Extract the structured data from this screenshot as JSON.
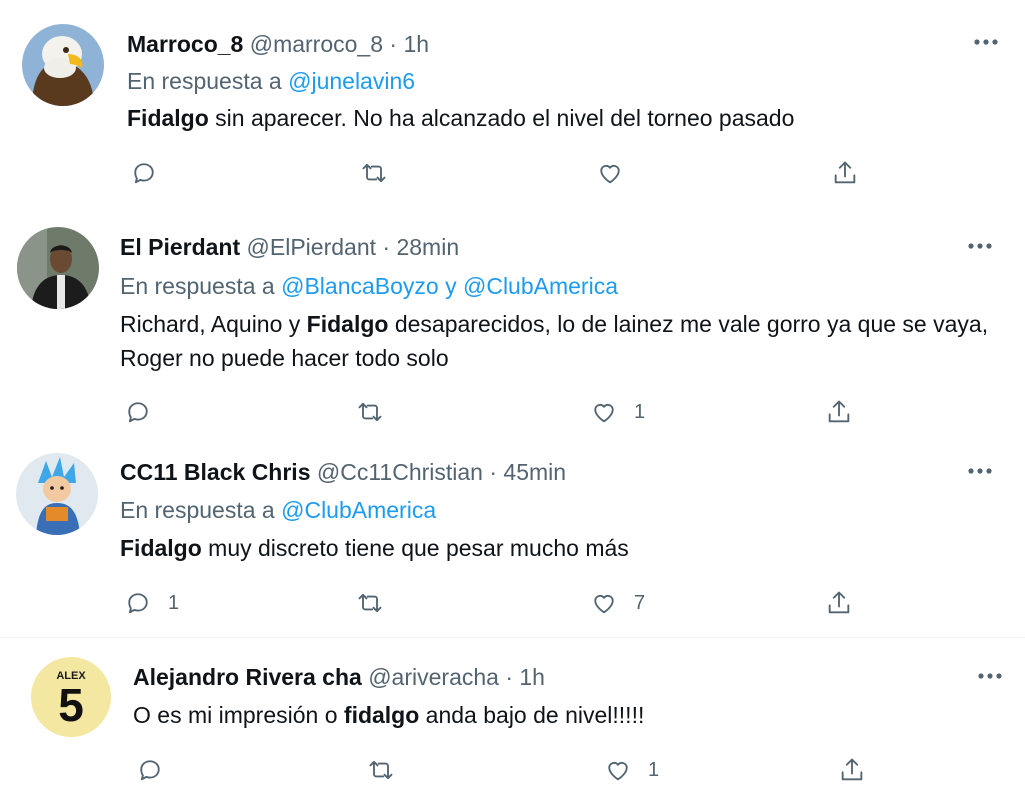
{
  "tweets": [
    {
      "display_name": "Marroco_8",
      "handle": "@marroco_8",
      "dot": "·",
      "time": "1h",
      "reply_prefix": "En respuesta a",
      "reply_to": "@junelavin6",
      "text": [
        {
          "t": "Fidalgo",
          "b": true
        },
        {
          "t": " sin aparecer. No ha alcanzado el nivel del torneo pasado",
          "b": false
        }
      ],
      "counts": {
        "reply": "",
        "retweet": "",
        "like": "",
        "share": ""
      },
      "avatar_icon": "eagle-avatar"
    },
    {
      "display_name": "El Pierdant",
      "handle": "@ElPierdant",
      "dot": "·",
      "time": "28min",
      "reply_prefix": "En respuesta a",
      "reply_to": "@BlancaBoyzo y @ClubAmerica",
      "text": [
        {
          "t": "Richard, Aquino y ",
          "b": false
        },
        {
          "t": "Fidalgo",
          "b": true
        },
        {
          "t": " desaparecidos, lo de lainez me vale gorro ya que se vaya, Roger no puede hacer todo solo",
          "b": false
        }
      ],
      "counts": {
        "reply": "",
        "retweet": "",
        "like": "1",
        "share": ""
      },
      "avatar_icon": "person-photo-avatar"
    },
    {
      "display_name": "CC11 Black Chris",
      "handle": "@Cc11Christian",
      "dot": "·",
      "time": "45min",
      "reply_prefix": "En respuesta a",
      "reply_to": "@ClubAmerica",
      "text": [
        {
          "t": "Fidalgo",
          "b": true
        },
        {
          "t": " muy discreto tiene que pesar mucho más",
          "b": false
        }
      ],
      "counts": {
        "reply": "1",
        "retweet": "",
        "like": "7",
        "share": ""
      },
      "avatar_icon": "anime-character-avatar"
    },
    {
      "display_name": "Alejandro Rivera cha",
      "handle": "@ariveracha",
      "dot": "·",
      "time": "1h",
      "reply_prefix": "",
      "reply_to": "",
      "text": [
        {
          "t": "O es mi impresión o ",
          "b": false
        },
        {
          "t": "fidalgo",
          "b": true
        },
        {
          "t": " anda bajo de nivel!!!!!",
          "b": false
        }
      ],
      "counts": {
        "reply": "",
        "retweet": "",
        "like": "1",
        "share": ""
      },
      "avatar_icon": "alex-5-jersey-avatar",
      "avatar_text": {
        "top": "ALEX",
        "number": "5"
      }
    }
  ],
  "icons": {
    "more": "more-options-icon",
    "reply": "reply-bubble-icon",
    "retweet": "retweet-icon",
    "like": "heart-icon",
    "share": "share-upload-icon"
  },
  "colors": {
    "link": "#1d9bf0",
    "secondary_text": "#536471",
    "primary_text": "#0f1419",
    "separator": "#eff3f4"
  }
}
